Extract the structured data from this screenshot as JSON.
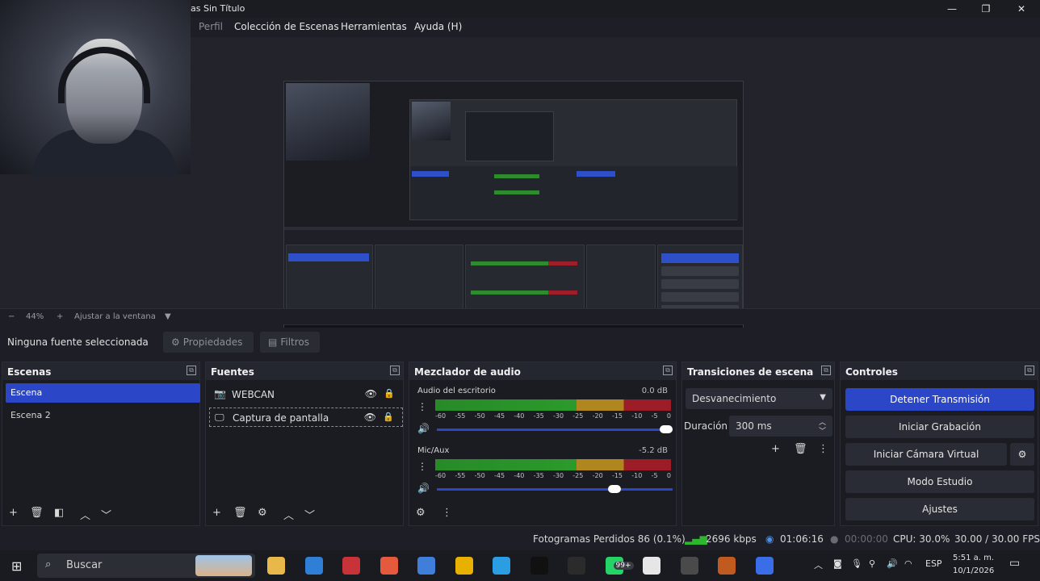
{
  "window": {
    "title": "as Sin Título",
    "minimize": "—",
    "maximize": "❐",
    "close": "✕"
  },
  "menu": {
    "items": [
      "Perfil",
      "Colección de Escenas",
      "Herramientas",
      "Ayuda (H)"
    ]
  },
  "zoom": {
    "minus": "−",
    "value": "44%",
    "plus": "+",
    "fit_label": "Ajustar a la ventana",
    "dropdown": "▼"
  },
  "source_toolbar": {
    "no_selection": "Ninguna fuente seleccionada",
    "properties": "Propiedades",
    "filters": "Filtros"
  },
  "scenes": {
    "title": "Escenas",
    "items": [
      "Escena",
      "Escena 2"
    ]
  },
  "sources": {
    "title": "Fuentes",
    "items": [
      "WEBCAN",
      "Captura de pantalla"
    ]
  },
  "mixer": {
    "title": "Mezclador de audio",
    "channels": [
      {
        "name": "Audio del escritorio",
        "db": "0.0 dB",
        "volume": 1.0
      },
      {
        "name": "Mic/Aux",
        "db": "-5.2 dB",
        "volume": 0.78
      }
    ],
    "ticks": [
      "-60",
      "-55",
      "-50",
      "-45",
      "-40",
      "-35",
      "-30",
      "-25",
      "-20",
      "-15",
      "-10",
      "-5",
      "0"
    ]
  },
  "transitions": {
    "title": "Transiciones de escena",
    "selected": "Desvanecimiento",
    "duration_label": "Duración",
    "duration_value": "300 ms"
  },
  "controls": {
    "title": "Controles",
    "stop_stream": "Detener Transmisión",
    "start_recording": "Iniciar Grabación",
    "start_virtual_cam": "Iniciar Cámara Virtual",
    "studio_mode": "Modo Estudio",
    "settings": "Ajustes"
  },
  "status": {
    "dropped_frames": "Fotogramas Perdidos 86 (0.1%)",
    "bitrate": "2696 kbps",
    "stream_time": "01:06:16",
    "record_time": "00:00:00",
    "cpu": "CPU: 30.0%",
    "fps": "30.00 / 30.00 FPS"
  },
  "taskbar": {
    "search_placeholder": "Buscar",
    "whatsapp_badge": "99+",
    "language": "ESP",
    "time": "5:51 a. m.",
    "date": "10/1/2026",
    "app_colors": [
      "#e8b84a",
      "#2f7fd6",
      "#c8333a",
      "#e55a3c",
      "#3f7fd9",
      "#e8b000",
      "#2b9de3",
      "#111111",
      "#2b2b2b",
      "#25d366",
      "#e6e6e6",
      "#4a4a4a",
      "#c05a1f",
      "#3a6ee8"
    ]
  },
  "colors": {
    "accent": "#2b47c8",
    "meter_green": "#2b9a2b",
    "meter_yellow": "#b0871f",
    "meter_red": "#9c1d28"
  }
}
